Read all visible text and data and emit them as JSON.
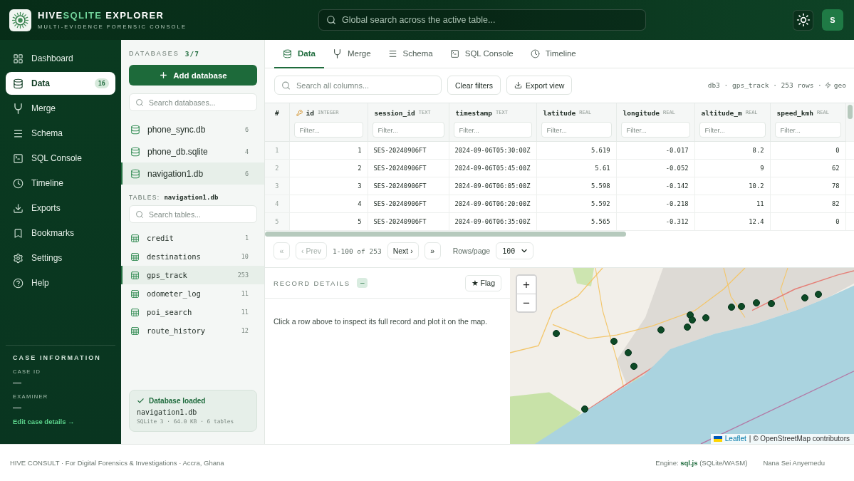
{
  "header": {
    "title_parts": [
      {
        "text": "HIVE",
        "accent": false
      },
      {
        "text": "SQLITE",
        "accent": true
      },
      {
        "text": " EXPLORER",
        "accent": false
      }
    ],
    "subtitle": "MULTI-EVIDENCE FORENSIC CONSOLE",
    "search": {
      "placeholder": "Global search across the active table..."
    },
    "avatar": "S"
  },
  "nav": [
    {
      "label": "Dashboard",
      "selected": false
    },
    {
      "label": "Data",
      "selected": true,
      "badge": "16"
    },
    {
      "label": "Merge",
      "selected": false
    },
    {
      "label": "Schema",
      "selected": false
    },
    {
      "label": "SQL Console",
      "selected": false
    },
    {
      "label": "Timeline",
      "selected": false
    },
    {
      "label": "Exports",
      "selected": false
    },
    {
      "label": "Bookmarks",
      "selected": false
    },
    {
      "label": "Settings",
      "selected": false
    },
    {
      "label": "Help",
      "selected": false
    }
  ],
  "case_info": {
    "title": "CASE INFORMATION",
    "fields": [
      {
        "label": "CASE ID",
        "value": "—"
      },
      {
        "label": "EXAMINER",
        "value": "—"
      }
    ],
    "edit_link": "Edit case details →"
  },
  "databases": {
    "title": "DATABASES",
    "count": "3/7",
    "add_button": "Add database",
    "search": {
      "placeholder": "Search databases..."
    },
    "items": [
      {
        "name": "phone_sync.db",
        "count": "6",
        "selected": false
      },
      {
        "name": "phone_db.sqlite",
        "count": "4",
        "selected": false
      },
      {
        "name": "navigation1.db",
        "count": "6",
        "selected": true
      }
    ]
  },
  "tables": {
    "title": "TABLES:",
    "source": "navigation1.db",
    "search": {
      "placeholder": "Search tables..."
    },
    "items": [
      {
        "name": "credit",
        "count": "1",
        "selected": false
      },
      {
        "name": "destinations",
        "count": "10",
        "selected": false
      },
      {
        "name": "gps_track",
        "count": "253",
        "selected": true
      },
      {
        "name": "odometer_log",
        "count": "11",
        "selected": false
      },
      {
        "name": "poi_search",
        "count": "11",
        "selected": false
      },
      {
        "name": "route_history",
        "count": "12",
        "selected": false
      }
    ]
  },
  "status_card": {
    "title": "Database loaded",
    "name": "navigation1.db",
    "details": "SQLite 3 · 64.0 KB · 6 tables"
  },
  "tabs": [
    {
      "label": "Data",
      "selected": true
    },
    {
      "label": "Merge",
      "selected": false
    },
    {
      "label": "Schema",
      "selected": false
    },
    {
      "label": "SQL Console",
      "selected": false
    },
    {
      "label": "Timeline",
      "selected": false
    }
  ],
  "toolbar": {
    "search": {
      "placeholder": "Search all columns..."
    },
    "clear_button": "Clear filters",
    "export_button": "Export view",
    "meta": "db3 · gps_track · 253 rows ·",
    "geo_tag": "geo"
  },
  "table": {
    "row_number_header": "#",
    "columns": [
      {
        "name": "id",
        "type": "INTEGER",
        "key": true,
        "filter_placeholder": "Filter..."
      },
      {
        "name": "session_id",
        "type": "TEXT",
        "key": false,
        "filter_placeholder": "Filter..."
      },
      {
        "name": "timestamp",
        "type": "TEXT",
        "key": false,
        "filter_placeholder": "Filter..."
      },
      {
        "name": "latitude",
        "type": "REAL",
        "key": false,
        "filter_placeholder": "Filter..."
      },
      {
        "name": "longitude",
        "type": "REAL",
        "key": false,
        "filter_placeholder": "Filter..."
      },
      {
        "name": "altitude_m",
        "type": "REAL",
        "key": false,
        "filter_placeholder": "Filter..."
      },
      {
        "name": "speed_kmh",
        "type": "REAL",
        "key": false,
        "filter_placeholder": "Filter..."
      }
    ],
    "rows": [
      {
        "number": "1",
        "cells": [
          "1",
          "SES-20240906FT",
          "2024-09-06T05:30:00Z",
          "5.619",
          "-0.017",
          "8.2",
          "0"
        ]
      },
      {
        "number": "2",
        "cells": [
          "2",
          "SES-20240906FT",
          "2024-09-06T05:45:00Z",
          "5.61",
          "-0.052",
          "9",
          "62"
        ]
      },
      {
        "number": "3",
        "cells": [
          "3",
          "SES-20240906FT",
          "2024-09-06T06:05:00Z",
          "5.598",
          "-0.142",
          "10.2",
          "78"
        ]
      },
      {
        "number": "4",
        "cells": [
          "4",
          "SES-20240906FT",
          "2024-09-06T06:20:00Z",
          "5.592",
          "-0.218",
          "11",
          "82"
        ]
      },
      {
        "number": "5",
        "cells": [
          "5",
          "SES-20240906FT",
          "2024-09-06T06:35:00Z",
          "5.565",
          "-0.312",
          "12.4",
          "0"
        ]
      }
    ]
  },
  "pagination": {
    "first": {
      "label": "«",
      "disabled": true
    },
    "prev": {
      "label": "‹ Prev",
      "disabled": true
    },
    "range": "1-100 of 253",
    "next": {
      "label": "Next ›",
      "disabled": false
    },
    "last": {
      "label": "»",
      "disabled": false
    },
    "rows_label": "Rows/page",
    "rows_value": "100"
  },
  "record_details": {
    "title": "RECORD DETAILS",
    "toggle": "–",
    "flag_button": "★ Flag",
    "hint": "Click a row above to inspect its full record and plot it on the map."
  },
  "map": {
    "zoom_in": "+",
    "zoom_out": "−",
    "attribution_link": "Leaflet",
    "attribution": "| © OpenStreetMap contributors"
  },
  "footer": {
    "credit": "HIVE CONSULT · For Digital Forensics & Investigations · Accra, Ghana",
    "engine": "Engine: **sql.js** (SQLite/WASM)",
    "user": "Nana Sei Anyemedu"
  }
}
